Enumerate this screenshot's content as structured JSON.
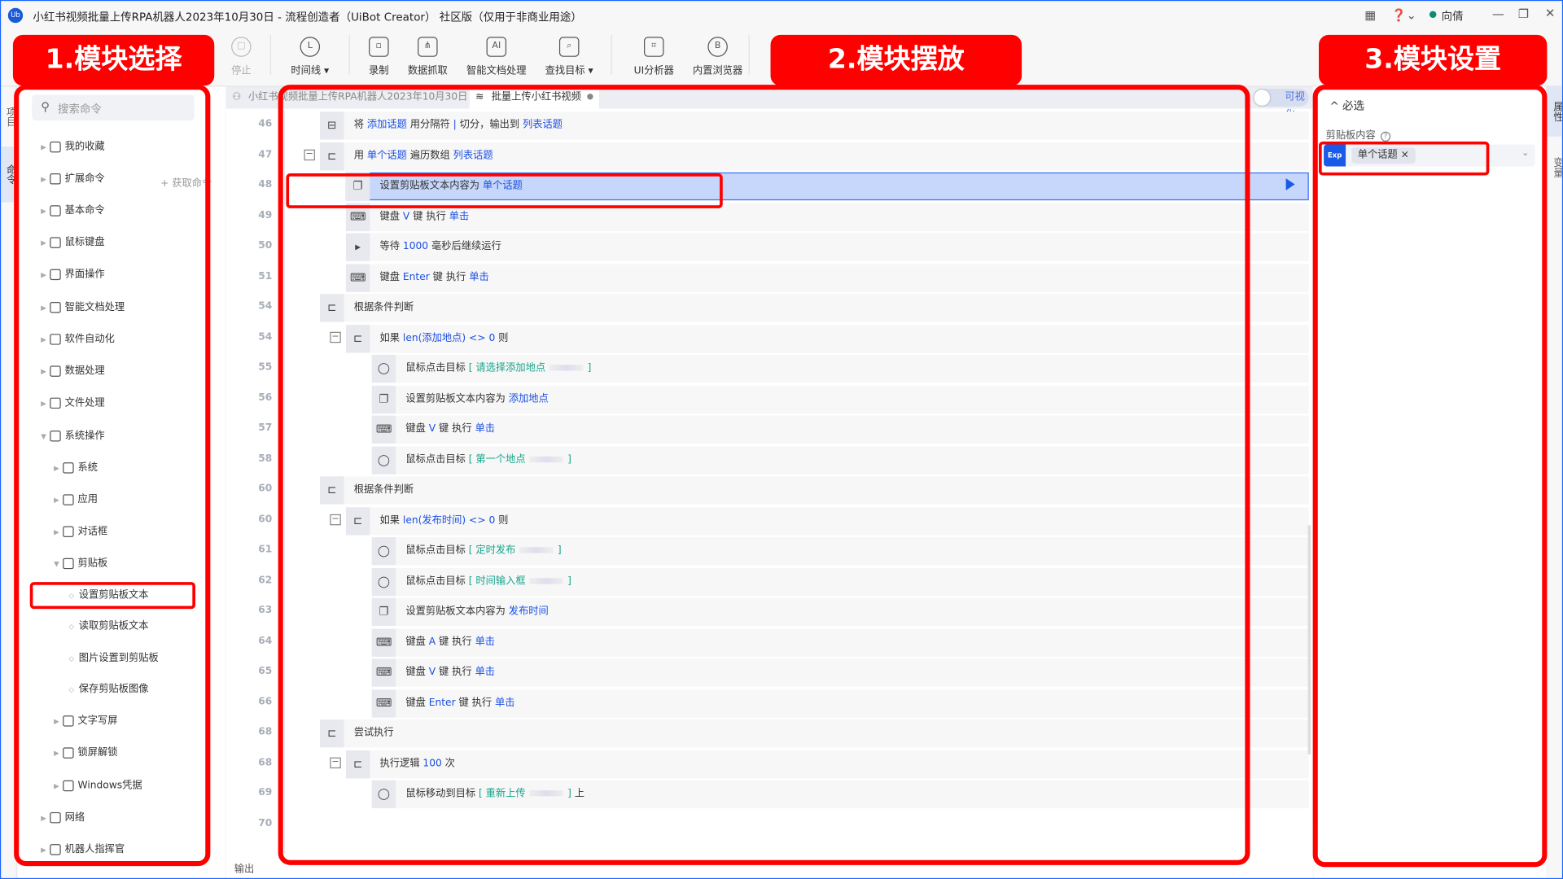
{
  "window": {
    "title": "小红书视频批量上传RPA机器人2023年10月30日 - 流程创造者（UiBot Creator） 社区版（仅用于非商业用途）",
    "logo": "Ub",
    "user": "向倩"
  },
  "toolbar": [
    {
      "label": "停止",
      "icon": "stop-icon",
      "glyph": "□",
      "disabled": true
    },
    {
      "label": "时间线 ▾",
      "icon": "clock-icon",
      "glyph": "L"
    },
    {
      "label": "录制",
      "icon": "record-icon",
      "glyph": "▫"
    },
    {
      "label": "数据抓取",
      "icon": "data-scrape-icon",
      "glyph": "⋔"
    },
    {
      "label": "智能文档处理",
      "icon": "ai-icon",
      "glyph": "AI"
    },
    {
      "label": "查找目标 ▾",
      "icon": "find-target-icon",
      "glyph": "⌕"
    },
    {
      "label": "UI分析器",
      "icon": "ui-analyzer-icon",
      "glyph": "⌗"
    },
    {
      "label": "内置浏览器",
      "icon": "browser-icon",
      "glyph": "B"
    }
  ],
  "left_tabs": [
    "项目",
    "命令"
  ],
  "right_tabs": [
    "属性",
    "变量"
  ],
  "sidebar": {
    "search_placeholder": "搜索命令",
    "get_command": "+ 获取命令",
    "items": [
      {
        "label": "我的收藏",
        "level": 0
      },
      {
        "label": "扩展命令",
        "level": 0
      },
      {
        "label": "基本命令",
        "level": 0
      },
      {
        "label": "鼠标键盘",
        "level": 0
      },
      {
        "label": "界面操作",
        "level": 0
      },
      {
        "label": "智能文档处理",
        "level": 0
      },
      {
        "label": "软件自动化",
        "level": 0
      },
      {
        "label": "数据处理",
        "level": 0
      },
      {
        "label": "文件处理",
        "level": 0
      },
      {
        "label": "系统操作",
        "level": 0,
        "open": true
      },
      {
        "label": "系统",
        "level": 1
      },
      {
        "label": "应用",
        "level": 1
      },
      {
        "label": "对话框",
        "level": 1
      },
      {
        "label": "剪贴板",
        "level": 1,
        "open": true
      },
      {
        "label": "设置剪贴板文本",
        "level": 2,
        "selected": true
      },
      {
        "label": "读取剪贴板文本",
        "level": 2
      },
      {
        "label": "图片设置到剪贴板",
        "level": 2
      },
      {
        "label": "保存剪贴板图像",
        "level": 2
      },
      {
        "label": "文字写屏",
        "level": 1
      },
      {
        "label": "锁屏解锁",
        "level": 1
      },
      {
        "label": "Windows凭据",
        "level": 1
      },
      {
        "label": "网络",
        "level": 0
      },
      {
        "label": "机器人指挥官",
        "level": 0
      }
    ]
  },
  "editor": {
    "tabs": [
      {
        "label": "小红书视频批量上传RPA机器人2023年10月30日",
        "active": false
      },
      {
        "label": "批量上传小红书视频",
        "active": true,
        "unsaved": true
      }
    ],
    "toggle_label": "可视化",
    "output_label": "输出",
    "rows": [
      {
        "ln": "46",
        "lv": 0,
        "icon": "split-icon",
        "g": "⊟",
        "seg": [
          {
            "t": "将 "
          },
          {
            "t": "添加话题",
            "c": "k"
          },
          {
            "t": " 用分隔符 "
          },
          {
            "t": "|",
            "c": "k"
          },
          {
            "t": " 切分，输出到 "
          },
          {
            "t": "列表话题",
            "c": "k"
          }
        ]
      },
      {
        "ln": "47",
        "lv": 0,
        "icon": "loop-icon",
        "g": "⊏",
        "coll": true,
        "seg": [
          {
            "t": "用 "
          },
          {
            "t": "单个话题",
            "c": "k"
          },
          {
            "t": " 遍历数组 "
          },
          {
            "t": "列表话题",
            "c": "k"
          }
        ]
      },
      {
        "ln": "48",
        "lv": 1,
        "icon": "clipboard-icon",
        "g": "❐",
        "sel": true,
        "seg": [
          {
            "t": "设置剪贴板文本内容为 "
          },
          {
            "t": "单个话题",
            "c": "k"
          }
        ]
      },
      {
        "ln": "49",
        "lv": 1,
        "icon": "keyboard-icon",
        "g": "⌨",
        "seg": [
          {
            "t": "键盘 "
          },
          {
            "t": "V",
            "c": "k"
          },
          {
            "t": " 键 执行 "
          },
          {
            "t": "单击",
            "c": "k"
          }
        ]
      },
      {
        "ln": "50",
        "lv": 1,
        "icon": "wait-icon",
        "g": "▸",
        "seg": [
          {
            "t": "等待 "
          },
          {
            "t": "1000",
            "c": "k"
          },
          {
            "t": " 毫秒后继续运行"
          }
        ]
      },
      {
        "ln": "51",
        "lv": 1,
        "icon": "keyboard-icon",
        "g": "⌨",
        "seg": [
          {
            "t": "键盘 "
          },
          {
            "t": "Enter",
            "c": "k"
          },
          {
            "t": " 键 执行 "
          },
          {
            "t": "单击",
            "c": "k"
          }
        ]
      },
      {
        "ln": "54",
        "lv": 0,
        "icon": "condition-icon",
        "g": "⊏",
        "seg": [
          {
            "t": "根据条件判断"
          }
        ]
      },
      {
        "ln": "54",
        "lv": 1,
        "icon": "condition-icon",
        "g": "⊏",
        "coll": true,
        "seg": [
          {
            "t": "如果 "
          },
          {
            "t": "len(添加地点) <> 0",
            "c": "k"
          },
          {
            "t": " 则"
          }
        ]
      },
      {
        "ln": "55",
        "lv": 2,
        "icon": "mouse-icon",
        "g": "◯",
        "seg": [
          {
            "t": "鼠标点击目标 "
          },
          {
            "t": "[ 请选择添加地点",
            "c": "g"
          },
          {
            "thumb": true
          },
          {
            "t": "]",
            "c": "g"
          }
        ]
      },
      {
        "ln": "56",
        "lv": 2,
        "icon": "clipboard-icon",
        "g": "❐",
        "seg": [
          {
            "t": "设置剪贴板文本内容为 "
          },
          {
            "t": "添加地点",
            "c": "k"
          }
        ]
      },
      {
        "ln": "57",
        "lv": 2,
        "icon": "keyboard-icon",
        "g": "⌨",
        "seg": [
          {
            "t": "键盘 "
          },
          {
            "t": "V",
            "c": "k"
          },
          {
            "t": " 键 执行 "
          },
          {
            "t": "单击",
            "c": "k"
          }
        ]
      },
      {
        "ln": "58",
        "lv": 2,
        "icon": "mouse-icon",
        "g": "◯",
        "seg": [
          {
            "t": "鼠标点击目标 "
          },
          {
            "t": "[ 第一个地点",
            "c": "g"
          },
          {
            "thumb": true
          },
          {
            "t": "]",
            "c": "g"
          }
        ]
      },
      {
        "ln": "60",
        "lv": 0,
        "icon": "condition-icon",
        "g": "⊏",
        "seg": [
          {
            "t": "根据条件判断"
          }
        ]
      },
      {
        "ln": "60",
        "lv": 1,
        "icon": "condition-icon",
        "g": "⊏",
        "coll": true,
        "seg": [
          {
            "t": "如果 "
          },
          {
            "t": "len(发布时间) <> 0",
            "c": "k"
          },
          {
            "t": " 则"
          }
        ]
      },
      {
        "ln": "61",
        "lv": 2,
        "icon": "mouse-icon",
        "g": "◯",
        "seg": [
          {
            "t": "鼠标点击目标 "
          },
          {
            "t": "[ 定时发布",
            "c": "g"
          },
          {
            "thumb": true
          },
          {
            "t": "]",
            "c": "g"
          }
        ]
      },
      {
        "ln": "62",
        "lv": 2,
        "icon": "mouse-icon",
        "g": "◯",
        "seg": [
          {
            "t": "鼠标点击目标 "
          },
          {
            "t": "[ 时间输入框",
            "c": "g"
          },
          {
            "thumb": true
          },
          {
            "t": "]",
            "c": "g"
          }
        ]
      },
      {
        "ln": "63",
        "lv": 2,
        "icon": "clipboard-icon",
        "g": "❐",
        "seg": [
          {
            "t": "设置剪贴板文本内容为 "
          },
          {
            "t": "发布时间",
            "c": "k"
          }
        ]
      },
      {
        "ln": "64",
        "lv": 2,
        "icon": "keyboard-icon",
        "g": "⌨",
        "seg": [
          {
            "t": "键盘 "
          },
          {
            "t": "A",
            "c": "k"
          },
          {
            "t": " 键 执行 "
          },
          {
            "t": "单击",
            "c": "k"
          }
        ]
      },
      {
        "ln": "65",
        "lv": 2,
        "icon": "keyboard-icon",
        "g": "⌨",
        "seg": [
          {
            "t": "键盘 "
          },
          {
            "t": "V",
            "c": "k"
          },
          {
            "t": " 键 执行 "
          },
          {
            "t": "单击",
            "c": "k"
          }
        ]
      },
      {
        "ln": "66",
        "lv": 2,
        "icon": "keyboard-icon",
        "g": "⌨",
        "seg": [
          {
            "t": "键盘 "
          },
          {
            "t": "Enter",
            "c": "k"
          },
          {
            "t": " 键 执行 "
          },
          {
            "t": "单击",
            "c": "k"
          }
        ]
      },
      {
        "ln": "68",
        "lv": 0,
        "icon": "try-icon",
        "g": "⊏",
        "seg": [
          {
            "t": "尝试执行"
          }
        ]
      },
      {
        "ln": "68",
        "lv": 1,
        "icon": "loop-icon",
        "g": "⊏",
        "coll": true,
        "seg": [
          {
            "t": "执行逻辑 "
          },
          {
            "t": "100",
            "c": "k"
          },
          {
            "t": " 次"
          }
        ]
      },
      {
        "ln": "69",
        "lv": 2,
        "icon": "mouse-icon",
        "g": "◯",
        "seg": [
          {
            "t": "鼠标移动到目标 "
          },
          {
            "t": "[ 重新上传",
            "c": "g"
          },
          {
            "thumb": true
          },
          {
            "t": "]",
            "c": "g"
          },
          {
            "t": " 上"
          }
        ]
      },
      {
        "ln": "70",
        "lv": 0,
        "empty": true,
        "seg": []
      }
    ]
  },
  "properties": {
    "section": "^ 必选",
    "field_label": "剪贴板内容",
    "help": "?",
    "exp_badge": "Exp",
    "chip": "单个话题",
    "chip_close": "×",
    "chevron": "⌄"
  },
  "annotations": {
    "label1": "1.模块选择",
    "label2": "2.模块摆放",
    "label3": "3.模块设置",
    "color": "#ff0000"
  },
  "colors": {
    "keyword": "#1a4fe0",
    "target": "#17a58a",
    "accent": "#1a5ae8",
    "selected_row": "#c7d7fb"
  }
}
